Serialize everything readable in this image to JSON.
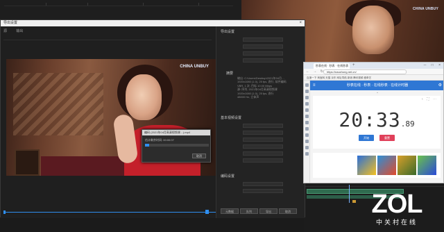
{
  "workspace": {
    "preview_logo": "CHINA UNBUY"
  },
  "export_dialog": {
    "title": "导出设置",
    "close_label": "×",
    "left_tabs": [
      "源",
      "输出"
    ],
    "video_brand": "CHINA UNBUY",
    "progress": {
      "title": "编码 (2021年04月高清视频课…).mp4",
      "text": "估计剩余时间: 00:00:07",
      "fraction": 0.07,
      "cancel_label": "取消"
    },
    "scrubber_fraction": 0.96,
    "settings": {
      "section_export": "导出设置",
      "section_basic": "基本视频设置",
      "section_encoding": "编码设置",
      "summary_label": "摘要",
      "summary_lines": [
        "输出: C:\\Users\\Desktop\\2021年04月…",
        "1920x1080 (1.0), 25 fps, 逐行, 软件编码",
        "VBR, 1 次, 目标 10.00 Mbps",
        "源: 序列, 2021年04月高清视频课",
        "1920x1080 (1.0), 25 fps, 逐行",
        "48000 Hz, 立体声"
      ],
      "buttons": [
        "元数据",
        "队列",
        "导出",
        "取消"
      ]
    }
  },
  "browser": {
    "tab_title": "秒表在线 · 秒表 · 在线秒表",
    "new_tab": "+",
    "window_controls": "─ □ ×",
    "nav_icons": "← → ↻",
    "url": "https://naozhong.net.cn/",
    "bookmarks": "百度一下  淘宝网  天猫  京东  网址导航  新浪  腾讯视频  爱奇艺",
    "site_title": "秒表在线 · 秒表 · 在线秒表 · 在线计时器",
    "chevron": "⌄",
    "card_icons": "‹ ⛶ ⋯",
    "time_main": "20:33",
    "time_ms": ".89",
    "start_label": "开始",
    "reset_label": "重置"
  },
  "watermark": {
    "logo": "ZOL",
    "sub": "中关村在线"
  },
  "colors": {
    "accent": "#2f8ff0",
    "site_blue": "#2f77d4",
    "reset_red": "#e0405a",
    "timeline_clip": "#2f6b4f"
  }
}
